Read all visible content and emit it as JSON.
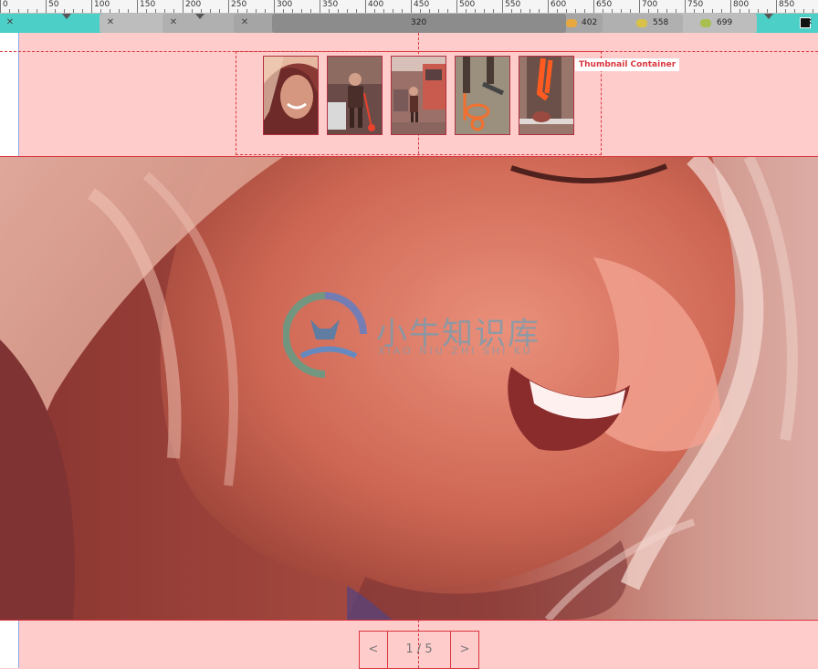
{
  "ruler": {
    "labels": [
      "0",
      "50",
      "100",
      "150",
      "200",
      "250",
      "300",
      "350",
      "400",
      "450",
      "500",
      "550",
      "600",
      "650",
      "700",
      "750",
      "800",
      "850"
    ]
  },
  "breakpoints": {
    "current_width": "320",
    "widths": [
      "402",
      "558",
      "699"
    ],
    "colors": {
      "b402": "#e8a840",
      "b558": "#d9c048",
      "b699": "#a9c050",
      "bar": "#4ccfc6"
    }
  },
  "thumbnail_container": {
    "label": "Thumbnail Container",
    "thumbnails": [
      {
        "name": "woman-smiling"
      },
      {
        "name": "man-with-scooter"
      },
      {
        "name": "street-with-bus"
      },
      {
        "name": "legs-with-scooter"
      },
      {
        "name": "orange-scooter-handle"
      }
    ]
  },
  "watermark": {
    "title": "小牛知识库",
    "subtitle": "XIAO NIU ZHI SHI KU"
  },
  "pagination": {
    "prev_label": "<",
    "page_label": "1 / 5",
    "next_label": ">"
  },
  "icons": {
    "close": "close-icon",
    "color_square": "color-square-icon"
  },
  "accent_color": "#d9363e"
}
